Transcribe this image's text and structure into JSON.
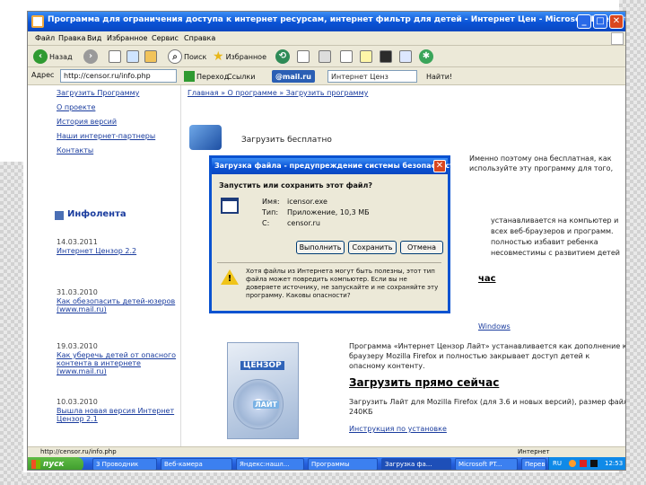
{
  "window": {
    "title": "Программа для ограничения доступа к интернет ресурсам, интернет фильтр для детей - Интернет Цен - Microsoft Internet Explorer",
    "minimize": "_",
    "maximize": "□",
    "close": "✕"
  },
  "menu": [
    "Файл",
    "Правка",
    "Вид",
    "Избранное",
    "Сервис",
    "Справка"
  ],
  "toolbar": {
    "back_label": "Назад",
    "search_label": "Поиск",
    "favorites_label": "Избранное"
  },
  "addressbar": {
    "label": "Адрес",
    "value": "http://censor.ru/info.php",
    "go_label": "Переход",
    "links_label": "Ссылки",
    "mail_label": "@mail.ru",
    "search_placeholder": "Интернет Ценз",
    "find_label": "Найти!"
  },
  "sidebar": {
    "nav": [
      "Загрузить Программу",
      "О проекте",
      "История версий",
      "Наши интернет-партнеры",
      "Контакты"
    ],
    "info_heading": "Инфолента",
    "news": [
      {
        "date": "14.03.2011",
        "text": "Интернет Цензор 2.2"
      },
      {
        "date": "31.03.2010",
        "text": "Как обезопасить детей-юзеров (www.mail.ru)"
      },
      {
        "date": "19.03.2010",
        "text": "Как уберечь детей от опасного контента в интернете (www.mail.ru)"
      },
      {
        "date": "10.03.2010",
        "text": "Вышла новая версия Интернет Цензор 2.1"
      }
    ]
  },
  "main": {
    "breadcrumb": "Главная » О программе » Загрузить программу",
    "download_free": "Загрузить бесплатно",
    "right_text_1": "Именно поэтому она бесплатная, как",
    "right_text_2": "используйте эту программу для того,",
    "right_text_3": "устанавливается на компьютер и",
    "right_text_4": "всех веб-браузеров и программ.",
    "right_text_5": "полностью избавит ребенка",
    "right_text_6": "несовместимы с развитием детей",
    "link_fragment_1": "час",
    "link_fragment_2": "Windows",
    "product_name": "ЦЕНЗОР",
    "product_subname": "ЛАЙТ",
    "lite_text_1": "Программа «Интернет Цензор Лайт» устанавливается как дополнение к",
    "lite_text_2": "браузеру Mozilla Firefox и полностью закрывает доступ детей к",
    "lite_text_3": "опасному контенту.",
    "download_now": "Загрузить прямо сейчас",
    "version_text_1": "Загрузить Лайт для Mozilla Firefox (для 3.6 и новых версий), размер файла",
    "version_text_2": "240КБ",
    "install_instructions": "Инструкция по установке"
  },
  "dialog": {
    "title": "Загрузка файла - предупреждение системы безопасности",
    "question": "Запустить или сохранить этот файл?",
    "name_label": "Имя:",
    "name_value": "icensor.exe",
    "type_label": "Тип:",
    "type_value": "Приложение, 10,3 МБ",
    "from_label": "С:",
    "from_value": "censor.ru",
    "run": "Выполнить",
    "save": "Сохранить",
    "cancel": "Отмена",
    "warning": "Хотя файлы из Интернета могут быть полезны, этот тип файла может повредить компьютер. Если вы не доверяете источнику, не запускайте и не сохраняйте эту программу. Каковы опасности?"
  },
  "statusbar": {
    "url": "http://censor.ru/info.php",
    "zone": "Интернет"
  },
  "taskbar": {
    "start": "пуск",
    "tasks": [
      "3 Проводник",
      "Веб-камера",
      "Яндекс:нашл...",
      "Программы",
      "Загрузка фа...",
      "Microsoft PT...",
      "Перевод..."
    ],
    "lang": "RU",
    "clock": "12:53"
  }
}
